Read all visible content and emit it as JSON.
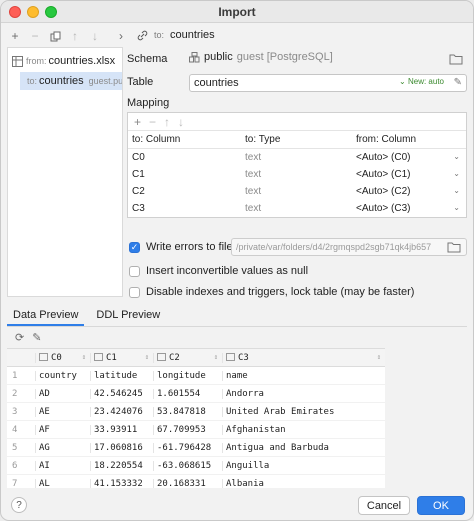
{
  "window": {
    "title": "Import"
  },
  "left_tree": {
    "items": [
      {
        "prefix": "from:",
        "label": "countries.xlsx"
      },
      {
        "prefix": "to:",
        "label": "countries",
        "suffix": "guest.pu"
      }
    ]
  },
  "breadcrumb": {
    "prefix": "to:",
    "label": "countries"
  },
  "schema": {
    "label": "Schema",
    "name": "public",
    "detail": "guest [PostgreSQL]"
  },
  "table": {
    "label": "Table",
    "value": "countries",
    "badge": "New: auto"
  },
  "mapping": {
    "label": "Mapping",
    "headers": [
      "to: Column",
      "to: Type",
      "from: Column"
    ],
    "rows": [
      {
        "to_column": "C0",
        "to_type": "text",
        "from_column": "<Auto> (C0)"
      },
      {
        "to_column": "C1",
        "to_type": "text",
        "from_column": "<Auto> (C1)"
      },
      {
        "to_column": "C2",
        "to_type": "text",
        "from_column": "<Auto> (C2)"
      },
      {
        "to_column": "C3",
        "to_type": "text",
        "from_column": "<Auto> (C3)"
      }
    ]
  },
  "options": {
    "write_errors": {
      "label": "Write errors to file",
      "checked": true,
      "path": "/private/var/folders/d4/2rgmqspd2sgb71qk4jb657"
    },
    "insert_inconvertible": {
      "label": "Insert inconvertible values as null",
      "checked": false
    },
    "disable_indexes": {
      "label": "Disable indexes and triggers, lock table (may be faster)",
      "checked": false
    }
  },
  "tabs": [
    {
      "label": "Data Preview",
      "active": true
    },
    {
      "label": "DDL Preview",
      "active": false
    }
  ],
  "preview": {
    "headers": [
      "C0",
      "C1",
      "C2",
      "C3"
    ],
    "rows": [
      {
        "n": "1",
        "c0": "country",
        "c1": "latitude",
        "c2": "longitude",
        "c3": "name"
      },
      {
        "n": "2",
        "c0": "AD",
        "c1": "42.546245",
        "c2": "1.601554",
        "c3": "Andorra"
      },
      {
        "n": "3",
        "c0": "AE",
        "c1": "23.424076",
        "c2": "53.847818",
        "c3": "United Arab Emirates"
      },
      {
        "n": "4",
        "c0": "AF",
        "c1": "33.93911",
        "c2": "67.709953",
        "c3": "Afghanistan"
      },
      {
        "n": "5",
        "c0": "AG",
        "c1": "17.060816",
        "c2": "-61.796428",
        "c3": "Antigua and Barbuda"
      },
      {
        "n": "6",
        "c0": "AI",
        "c1": "18.220554",
        "c2": "-63.068615",
        "c3": "Anguilla"
      },
      {
        "n": "7",
        "c0": "AL",
        "c1": "41.153332",
        "c2": "20.168331",
        "c3": "Albania"
      }
    ]
  },
  "footer": {
    "help": "?",
    "cancel": "Cancel",
    "ok": "OK"
  }
}
